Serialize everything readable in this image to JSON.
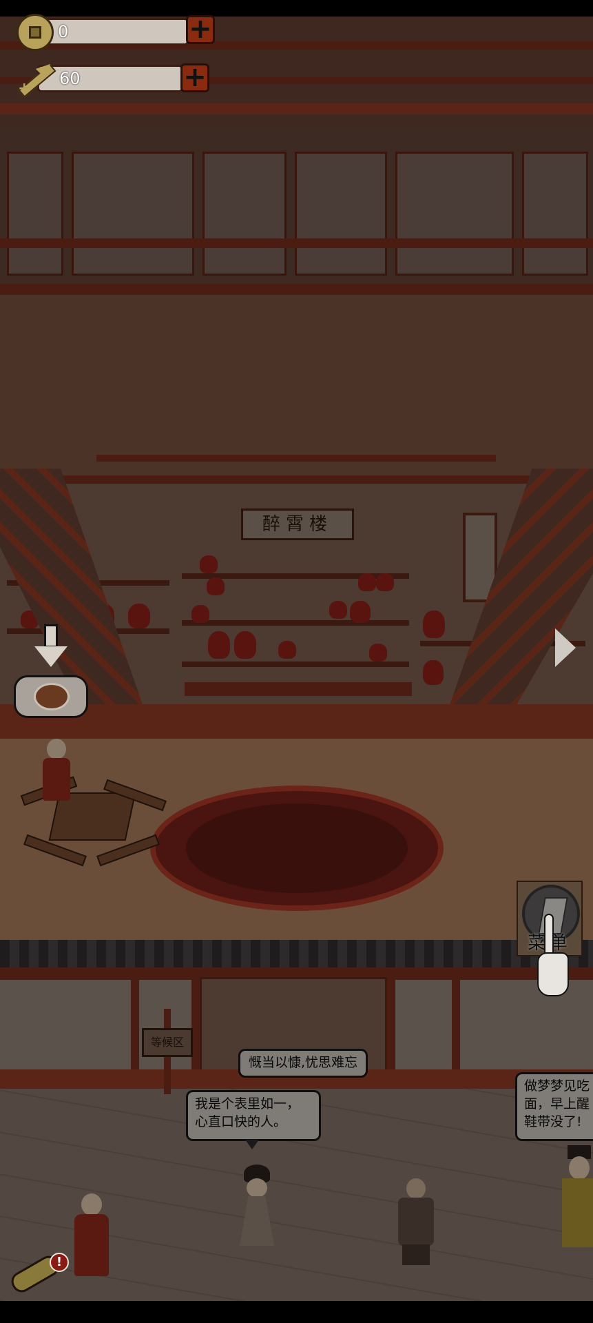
{
  "hud": {
    "coins": {
      "value": "0",
      "icon": "coin-icon",
      "add_icon": "plus-icon"
    },
    "energy": {
      "value": "60",
      "icon": "energy-arrow-icon",
      "add_icon": "plus-icon"
    }
  },
  "scene": {
    "inn_sign": "醉霄楼",
    "waiting_sign": "等候区",
    "menu_button": {
      "label": "菜单",
      "icon": "menu-book-icon",
      "hint_icon": "pointing-hand-icon"
    },
    "next_arrow": "chevron-right-icon",
    "order_indicator": {
      "icon": "down-arrow-icon",
      "dish_icon": "dish-icon"
    },
    "scroll_button": {
      "icon": "scroll-icon",
      "badge": "!"
    }
  },
  "dialogues": [
    {
      "id": "top",
      "text": "慨当以慷,忧思难忘"
    },
    {
      "id": "girl",
      "lines": [
        "我是个表里如一，",
        "心直口快的人。"
      ]
    },
    {
      "id": "right",
      "lines": [
        "做梦梦见吃",
        "面，早上醒",
        "鞋带没了!"
      ]
    }
  ],
  "colors": {
    "beam": "#4b1d12",
    "accent_red": "#8a2b10",
    "paper": "#e6e0d8"
  }
}
